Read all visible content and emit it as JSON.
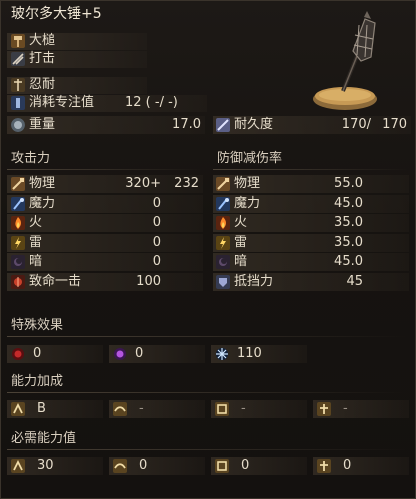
{
  "weapon": {
    "name": "玻尔多大锤+5",
    "type": "大槌",
    "attack_type": "打击",
    "skill": "忍耐",
    "fp_cost_label": "消耗专注值",
    "fp_cost_value": "12 (  -/  -)",
    "weight_label": "重量",
    "weight_value": "17.0",
    "durability_label": "耐久度",
    "durability_current": "170/",
    "durability_max": "170"
  },
  "attack": {
    "header": "攻击力",
    "rows": [
      {
        "icon": "physical-icon",
        "label": "物理",
        "value": "320+",
        "bonus": "232"
      },
      {
        "icon": "magic-icon",
        "label": "魔力",
        "value": "0",
        "bonus": ""
      },
      {
        "icon": "fire-icon",
        "label": "火",
        "value": "0",
        "bonus": ""
      },
      {
        "icon": "lightning-icon",
        "label": "雷",
        "value": "0",
        "bonus": ""
      },
      {
        "icon": "dark-icon",
        "label": "暗",
        "value": "0",
        "bonus": ""
      },
      {
        "icon": "critical-icon",
        "label": "致命一击",
        "value": "100",
        "bonus": ""
      }
    ]
  },
  "defense": {
    "header": "防御减伤率",
    "rows": [
      {
        "icon": "physical-icon",
        "label": "物理",
        "value": "55.0"
      },
      {
        "icon": "magic-icon",
        "label": "魔力",
        "value": "45.0"
      },
      {
        "icon": "fire-icon",
        "label": "火",
        "value": "35.0"
      },
      {
        "icon": "lightning-icon",
        "label": "雷",
        "value": "35.0"
      },
      {
        "icon": "dark-icon",
        "label": "暗",
        "value": "45.0"
      },
      {
        "icon": "stability-icon",
        "label": "抵挡力",
        "value": "45"
      }
    ]
  },
  "special": {
    "header": "特殊效果",
    "items": [
      {
        "icon": "bleed-icon",
        "value": "0"
      },
      {
        "icon": "poison-icon",
        "value": "0"
      },
      {
        "icon": "frost-icon",
        "value": "110"
      }
    ]
  },
  "scaling": {
    "header": "能力加成",
    "items": [
      {
        "icon": "strength-icon",
        "value": "B"
      },
      {
        "icon": "dexterity-icon",
        "value": "-"
      },
      {
        "icon": "intelligence-icon",
        "value": "-"
      },
      {
        "icon": "faith-icon",
        "value": "-"
      }
    ]
  },
  "requirements": {
    "header": "必需能力值",
    "items": [
      {
        "icon": "strength-icon",
        "value": "30"
      },
      {
        "icon": "dexterity-icon",
        "value": "0"
      },
      {
        "icon": "intelligence-icon",
        "value": "0"
      },
      {
        "icon": "faith-icon",
        "value": "0"
      }
    ]
  }
}
